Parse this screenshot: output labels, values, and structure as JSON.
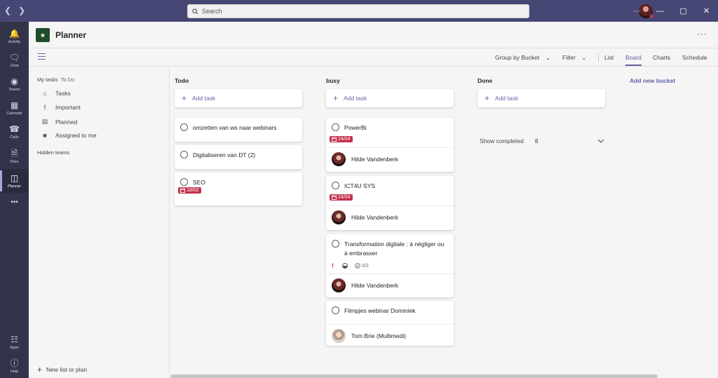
{
  "titlebar": {
    "search_placeholder": "Search"
  },
  "rail": [
    {
      "label": "Activity",
      "icon": "bell-icon"
    },
    {
      "label": "Chat",
      "icon": "chat-icon"
    },
    {
      "label": "Teams",
      "icon": "teams-icon"
    },
    {
      "label": "Calendar",
      "icon": "calendar-icon"
    },
    {
      "label": "Calls",
      "icon": "phone-icon"
    },
    {
      "label": "Files",
      "icon": "file-icon"
    },
    {
      "label": "Planner",
      "icon": "planner-icon",
      "active": true
    },
    {
      "label": "Apps",
      "icon": "apps-icon"
    },
    {
      "label": "Help",
      "icon": "help-icon"
    }
  ],
  "app": {
    "title": "Planner",
    "more": "···"
  },
  "toolbar": {
    "group_by": "Group by Bucket",
    "filter": "Filter",
    "views": [
      "List",
      "Board",
      "Charts",
      "Schedule"
    ],
    "active_view": "Board"
  },
  "leftnav": {
    "my_tasks": "My tasks",
    "todo_app": "To Do",
    "items": [
      "Tasks",
      "Important",
      "Planned",
      "Assigned to me"
    ],
    "hidden_teams": "Hidden teams",
    "new_list": "New list or plan"
  },
  "board": {
    "add_task_label": "Add task",
    "add_bucket": "Add new bucket",
    "buckets": [
      {
        "name": "Todo",
        "tasks": [
          {
            "title": "omzetten van ws naar webinars"
          },
          {
            "title": "Digitaliseren van DT (2)"
          },
          {
            "title": "SEO",
            "due": "18/02"
          }
        ]
      },
      {
        "name": "busy",
        "tasks": [
          {
            "title": "PowerBi",
            "due": "24/04",
            "assignee": "Hilde Vandenberk"
          },
          {
            "title": "ICT4U SYS",
            "due": "24/04",
            "assignee": "Hilde Vandenberk"
          },
          {
            "title": "Transformation digitale : à négliger ou à embrasser",
            "priority": "!",
            "checklist": "0/2",
            "assignee": "Hilde Vandenberk"
          },
          {
            "title": "Filmpjes webinar Dominiek",
            "assignee": "Tom Brie (Multimedi)"
          }
        ]
      },
      {
        "name": "Done",
        "show_completed": "Show completed",
        "completed_count": "8"
      }
    ]
  },
  "colors": {
    "accent": "#6264a7",
    "titlebar": "#464775",
    "rail": "#33344a",
    "due_badge": "#c4314b"
  }
}
